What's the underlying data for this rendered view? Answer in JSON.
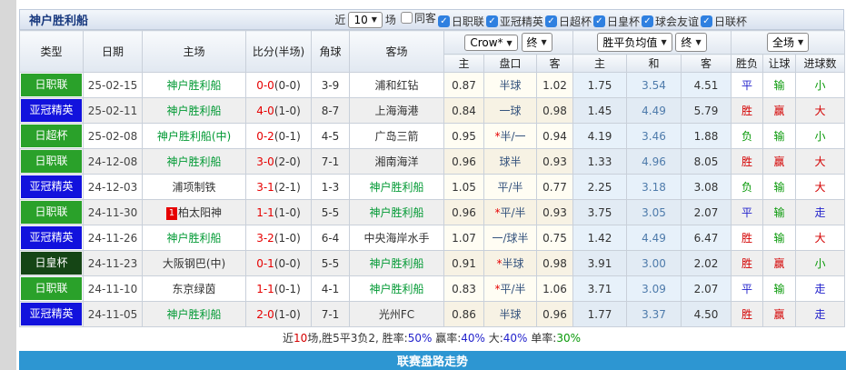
{
  "header": {
    "team_title": "神户胜利船",
    "recent_label": "近",
    "recent_count": "10",
    "matches_label": "场",
    "filters": [
      {
        "label": "同客",
        "checked": false
      },
      {
        "label": "日职联",
        "checked": true
      },
      {
        "label": "亚冠精英",
        "checked": true
      },
      {
        "label": "日超杯",
        "checked": true
      },
      {
        "label": "日皇杯",
        "checked": true
      },
      {
        "label": "球会友谊",
        "checked": true
      },
      {
        "label": "日联杯",
        "checked": true
      }
    ]
  },
  "table": {
    "columns": [
      "类型",
      "日期",
      "主场",
      "比分(半场)",
      "角球",
      "客场"
    ],
    "selects": {
      "company": "Crow*",
      "company_time": "终",
      "avg": "胜平负均值",
      "avg_time": "终",
      "scope": "全场"
    },
    "sub_columns": [
      "主",
      "盘口",
      "客",
      "主",
      "和",
      "客",
      "胜负",
      "让球",
      "进球数"
    ],
    "rows": [
      {
        "type": "日职联",
        "type_color": "green",
        "date": "25-02-15",
        "home": "神户胜利船",
        "home_green": true,
        "score": "0-0",
        "half": "(0-0)",
        "corner": "3-9",
        "away": "浦和红钻",
        "away_green": false,
        "odds_home": "0.87",
        "handicap": "半球",
        "odds_away": "1.02",
        "avg_home": "1.75",
        "avg_draw": "3.54",
        "avg_away": "4.51",
        "result": "平",
        "result_color": "blue",
        "handicap_result": "输",
        "handicap_result_color": "green",
        "goals_result": "小",
        "goals_result_color": "green"
      },
      {
        "type": "亚冠精英",
        "type_color": "blue",
        "date": "25-02-11",
        "home": "神户胜利船",
        "home_green": true,
        "score": "4-0",
        "half": "(1-0)",
        "corner": "8-7",
        "away": "上海海港",
        "away_green": false,
        "odds_home": "0.84",
        "handicap": "一球",
        "odds_away": "0.98",
        "avg_home": "1.45",
        "avg_draw": "4.49",
        "avg_away": "5.79",
        "result": "胜",
        "result_color": "red",
        "handicap_result": "赢",
        "handicap_result_color": "red",
        "goals_result": "大",
        "goals_result_color": "red"
      },
      {
        "type": "日超杯",
        "type_color": "green",
        "date": "25-02-08",
        "home": "神户胜利船(中)",
        "home_green": true,
        "score": "0-2",
        "half": "(0-1)",
        "corner": "4-5",
        "away": "广岛三箭",
        "away_green": false,
        "odds_home": "0.95",
        "handicap": "*半/一",
        "odds_away": "0.94",
        "avg_home": "4.19",
        "avg_draw": "3.46",
        "avg_away": "1.88",
        "result": "负",
        "result_color": "green",
        "handicap_result": "输",
        "handicap_result_color": "green",
        "goals_result": "小",
        "goals_result_color": "green"
      },
      {
        "type": "日职联",
        "type_color": "green",
        "date": "24-12-08",
        "home": "神户胜利船",
        "home_green": true,
        "score": "3-0",
        "half": "(2-0)",
        "corner": "7-1",
        "away": "湘南海洋",
        "away_green": false,
        "odds_home": "0.96",
        "handicap": "球半",
        "odds_away": "0.93",
        "avg_home": "1.33",
        "avg_draw": "4.96",
        "avg_away": "8.05",
        "result": "胜",
        "result_color": "red",
        "handicap_result": "赢",
        "handicap_result_color": "red",
        "goals_result": "大",
        "goals_result_color": "red"
      },
      {
        "type": "亚冠精英",
        "type_color": "blue",
        "date": "24-12-03",
        "home": "浦项制铁",
        "home_green": false,
        "score": "3-1",
        "half": "(2-1)",
        "corner": "1-3",
        "away": "神户胜利船",
        "away_green": true,
        "odds_home": "1.05",
        "handicap": "平/半",
        "odds_away": "0.77",
        "avg_home": "2.25",
        "avg_draw": "3.18",
        "avg_away": "3.08",
        "result": "负",
        "result_color": "green",
        "handicap_result": "输",
        "handicap_result_color": "green",
        "goals_result": "大",
        "goals_result_color": "red"
      },
      {
        "type": "日职联",
        "type_color": "green",
        "date": "24-11-30",
        "home": "柏太阳神",
        "home_rank": "1",
        "home_green": false,
        "score": "1-1",
        "half": "(1-0)",
        "corner": "5-5",
        "away": "神户胜利船",
        "away_green": true,
        "odds_home": "0.96",
        "handicap": "*平/半",
        "odds_away": "0.93",
        "avg_home": "3.75",
        "avg_draw": "3.05",
        "avg_away": "2.07",
        "result": "平",
        "result_color": "blue",
        "handicap_result": "输",
        "handicap_result_color": "green",
        "goals_result": "走",
        "goals_result_color": "blue"
      },
      {
        "type": "亚冠精英",
        "type_color": "blue",
        "date": "24-11-26",
        "home": "神户胜利船",
        "home_green": true,
        "score": "3-2",
        "half": "(1-0)",
        "corner": "6-4",
        "away": "中央海岸水手",
        "away_green": false,
        "odds_home": "1.07",
        "handicap": "一/球半",
        "odds_away": "0.75",
        "avg_home": "1.42",
        "avg_draw": "4.49",
        "avg_away": "6.47",
        "result": "胜",
        "result_color": "red",
        "handicap_result": "输",
        "handicap_result_color": "green",
        "goals_result": "大",
        "goals_result_color": "red"
      },
      {
        "type": "日皇杯",
        "type_color": "darkgreen",
        "date": "24-11-23",
        "home": "大阪钢巴(中)",
        "home_green": false,
        "score": "0-1",
        "half": "(0-0)",
        "corner": "5-5",
        "away": "神户胜利船",
        "away_green": true,
        "odds_home": "0.91",
        "handicap": "*半球",
        "odds_away": "0.98",
        "avg_home": "3.91",
        "avg_draw": "3.00",
        "avg_away": "2.02",
        "result": "胜",
        "result_color": "red",
        "handicap_result": "赢",
        "handicap_result_color": "red",
        "goals_result": "小",
        "goals_result_color": "green"
      },
      {
        "type": "日职联",
        "type_color": "green",
        "date": "24-11-10",
        "home": "东京绿茵",
        "home_green": false,
        "score": "1-1",
        "half": "(0-1)",
        "corner": "4-1",
        "away": "神户胜利船",
        "away_green": true,
        "odds_home": "0.83",
        "handicap": "*平/半",
        "odds_away": "1.06",
        "avg_home": "3.71",
        "avg_draw": "3.09",
        "avg_away": "2.07",
        "result": "平",
        "result_color": "blue",
        "handicap_result": "输",
        "handicap_result_color": "green",
        "goals_result": "走",
        "goals_result_color": "blue"
      },
      {
        "type": "亚冠精英",
        "type_color": "blue",
        "date": "24-11-05",
        "home": "神户胜利船",
        "home_green": true,
        "score": "2-0",
        "half": "(1-0)",
        "corner": "7-1",
        "away": "光州FC",
        "away_green": false,
        "odds_home": "0.86",
        "handicap": "半球",
        "odds_away": "0.96",
        "avg_home": "1.77",
        "avg_draw": "3.37",
        "avg_away": "4.50",
        "result": "胜",
        "result_color": "red",
        "handicap_result": "赢",
        "handicap_result_color": "red",
        "goals_result": "走",
        "goals_result_color": "blue"
      }
    ]
  },
  "summary": {
    "segments": [
      {
        "text": "近",
        "color": "dark"
      },
      {
        "text": "10",
        "color": "red"
      },
      {
        "text": "场,胜5平3负2, 胜率:",
        "color": "dark"
      },
      {
        "text": "50%",
        "color": "blue"
      },
      {
        "text": " 赢率:",
        "color": "dark"
      },
      {
        "text": "40%",
        "color": "blue"
      },
      {
        "text": " 大:",
        "color": "dark"
      },
      {
        "text": "40%",
        "color": "blue"
      },
      {
        "text": " 单率:",
        "color": "dark"
      },
      {
        "text": "30%",
        "color": "green"
      }
    ]
  },
  "footer": {
    "title": "联赛盘路走势"
  },
  "colors": {
    "footer_blue": "#2d96d2",
    "badge_green": "#2aa12a",
    "badge_blue": "#1212dd",
    "badge_darkgreen": "#154515",
    "team_green": "#009933",
    "score_red": "#e60000",
    "win_red": "#d40000",
    "draw_blue": "#2323cc",
    "lose_green": "#089908"
  }
}
